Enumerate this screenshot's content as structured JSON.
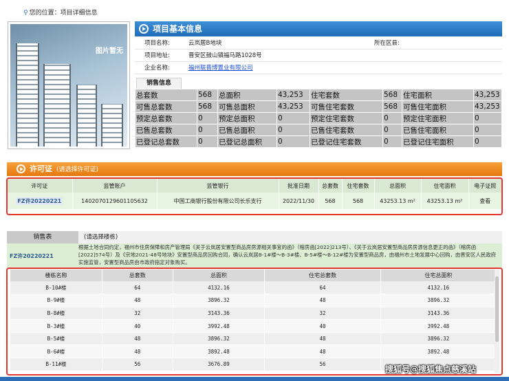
{
  "location": "您的位置：项目详细信息",
  "photo_label": "图片暂无",
  "project": {
    "title": "项目基本信息",
    "name_label": "项目名称:",
    "name": "云岚居B地块",
    "district_label": "所在区县:",
    "district": "",
    "address_label": "项目地址:",
    "address": "晋安区鼓山镇福马路1028号",
    "company_label": "企业名称:",
    "company": "福州联晋博置业有限公司"
  },
  "sales": {
    "tab": "销售信息",
    "rows": [
      [
        "总套数",
        "568",
        "总面积",
        "43,253",
        "住宅套数",
        "568",
        "住宅面积",
        "43,253"
      ],
      [
        "可售总套数",
        "568",
        "可售总面积",
        "43,253",
        "可售住宅套数",
        "568",
        "可售住宅面积",
        "43,253"
      ],
      [
        "预定总套数",
        "0",
        "预定总面积",
        "0",
        "预定住宅套数",
        "0",
        "预定住宅面积",
        "0"
      ],
      [
        "已售总套数",
        "0",
        "已售总面积",
        "0",
        "已售住宅套数",
        "0",
        "已售住宅面积",
        "0"
      ],
      [
        "已登记总套数",
        "0",
        "已登记总面积",
        "0",
        "已登记住宅套数",
        "0",
        "已登记住宅面积",
        "0"
      ]
    ]
  },
  "permit": {
    "title": "许可证",
    "hint": "(请选择许可证)",
    "headers": [
      "许可证",
      "监管账户",
      "监管银行",
      "批准日期",
      "总套数",
      "住宅套数",
      "总面积",
      "住宅面积",
      "电子证照"
    ],
    "row": {
      "no": "FZ许20220221",
      "account": "140207012960110563​2",
      "bank": "中国工商银行股份有限公司长乐支行",
      "date": "2022/11/30",
      "total_units": "568",
      "res_units": "568",
      "total_area": "43253.13 m²",
      "res_area": "43253.13 m²",
      "view": "查看"
    }
  },
  "sale_table": {
    "tab": "销售表",
    "hint": "(请选择楼栋)",
    "permit_no": "FZ许20220221",
    "desc": "根据土地合同约定，福州市住房保障和房产管理局《关于云岚居安置型商品房房源相关事宜的函》（榕房函[2022]213号）、《关于云岚居安置型商品房房源信息更正的函》（榕房函[2022]574号）及《宗地2021-48号地块》安置型商品房回购合同，确认云岚居B-1#楼～B-3#楼、B-5#楼～B-12#楼为安置型商品房，由福州市土地发展中心回购，由晋安区人民政府实施监管，安置型商品房由市政府指定对象购买。",
    "headers": [
      "楼栋名称",
      "总套数",
      "总面积",
      "住宅总套数",
      "住宅总面积"
    ],
    "rows": [
      [
        "B-10#楼",
        "64",
        "4132.16",
        "64",
        "4132.16"
      ],
      [
        "B-9#楼",
        "48",
        "3896.32",
        "48",
        "3896.32"
      ],
      [
        "B-8#楼",
        "32",
        "3143.36",
        "32",
        "3143.36"
      ],
      [
        "B-3#楼",
        "40",
        "3992.48",
        "40",
        "3992.48"
      ],
      [
        "B-5#楼",
        "48",
        "3896.32",
        "48",
        "3896.32"
      ],
      [
        "B-6#楼",
        "48",
        "3892.48",
        "48",
        "3892.48"
      ],
      [
        "B-11#楼",
        "56",
        "3676.89",
        "56",
        ""
      ]
    ]
  },
  "watermark": "搜狐号@搜狐焦点慈溪站"
}
